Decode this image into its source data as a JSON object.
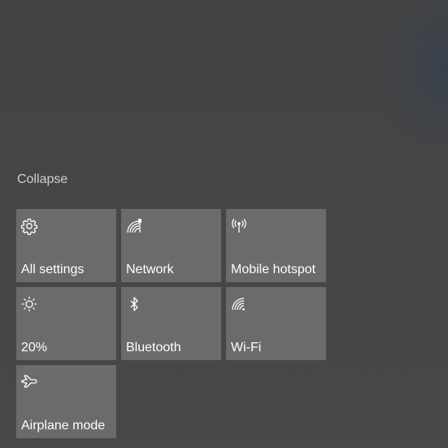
{
  "action_center": {
    "collapse_label": "Collapse",
    "tiles": [
      {
        "label": "All settings",
        "icon": "gear-icon"
      },
      {
        "label": "Network",
        "icon": "network-icon"
      },
      {
        "label": "Mobile hotspot",
        "icon": "mobile-hotspot-icon"
      },
      {
        "label": "20%",
        "icon": "brightness-icon"
      },
      {
        "label": "Bluetooth",
        "icon": "bluetooth-icon"
      },
      {
        "label": "Wi-Fi",
        "icon": "wifi-icon"
      },
      {
        "label": "Airplane mode",
        "icon": "airplane-icon"
      }
    ]
  },
  "colors": {
    "background": "#474747",
    "tile": "#6b6b6b",
    "collapse_text": "#cfcfcf",
    "text": "#ffffff"
  }
}
